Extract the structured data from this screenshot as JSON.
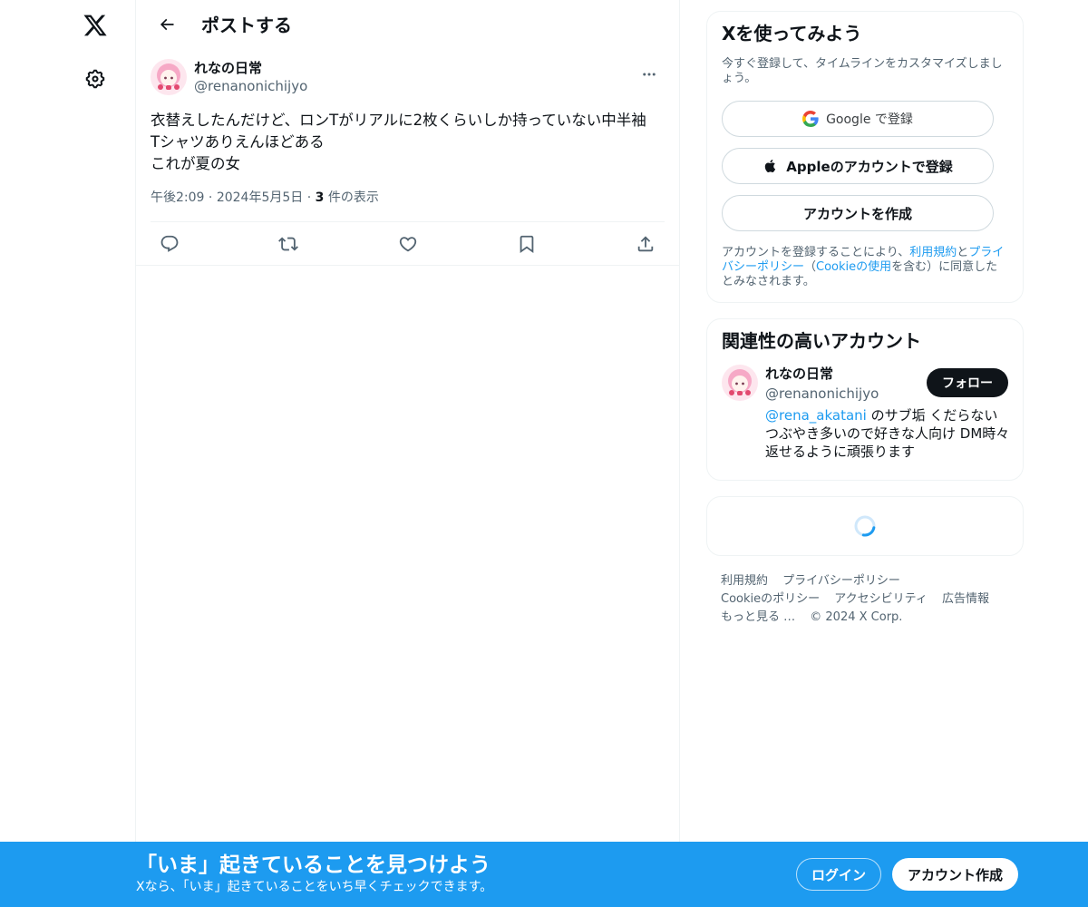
{
  "colors": {
    "accent": "#1d9bf0",
    "text": "#0f1419",
    "muted": "#536471",
    "border": "#eff3f4"
  },
  "nav": {
    "logo_icon": "x-logo-icon",
    "settings_icon": "gear-icon"
  },
  "header": {
    "title": "ポストする"
  },
  "post": {
    "author_name": "れなの日常",
    "author_handle": "@renanonichijyo",
    "text": "衣替えしたんだけど、ロンTがリアルに2枚くらいしか持っていない中半袖\nTシャツありえんほどある\nこれが夏の女",
    "time": "午後2:09",
    "date": "2024年5月5日",
    "separator": "·",
    "views_count": "3",
    "views_label": "件の表示"
  },
  "actions": [
    "reply-icon",
    "repost-icon",
    "like-icon",
    "bookmark-icon",
    "share-icon"
  ],
  "signup": {
    "title": "Xを使ってみよう",
    "subtitle": "今すぐ登録して、タイムラインをカスタマイズしましょう。",
    "google_label": "Google で登録",
    "apple_label": "Appleのアカウントで登録",
    "create_label": "アカウントを作成",
    "legal_pre": "アカウントを登録することにより、",
    "legal_terms": "利用規約",
    "legal_and": "と",
    "legal_privacy": "プライバシーポリシー",
    "legal_paren_open": "（",
    "legal_cookie": "Cookieの使用",
    "legal_post": "を含む）に同意したとみなされます。"
  },
  "related": {
    "title": "関連性の高いアカウント",
    "name": "れなの日常",
    "handle": "@renanonichijyo",
    "bio_mention": "@rena_akatani",
    "bio_text": " のサブ垢 くだらないつぶやき多いので好きな人向け DM時々返せるように頑張ります",
    "follow_label": "フォロー"
  },
  "footer": {
    "links": [
      "利用規約",
      "プライバシーポリシー",
      "Cookieのポリシー",
      "アクセシビリティ",
      "広告情報",
      "もっと見る …"
    ],
    "copyright": "© 2024 X Corp."
  },
  "banner": {
    "title": "「いま」起きていることを見つけよう",
    "subtitle": "Xなら、「いま」起きていることをいち早くチェックできます。",
    "login_label": "ログイン",
    "signup_label": "アカウント作成"
  }
}
